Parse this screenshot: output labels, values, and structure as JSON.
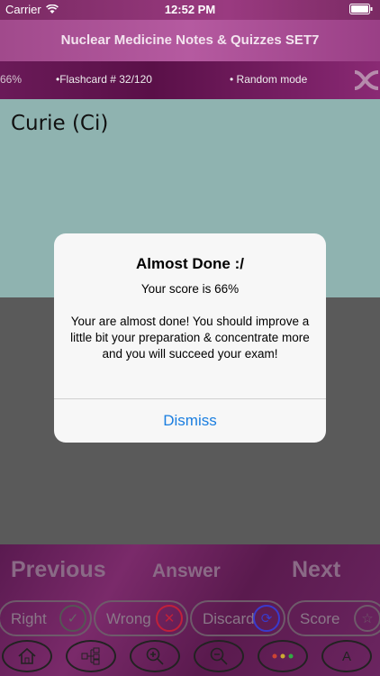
{
  "status_bar": {
    "carrier": "Carrier",
    "time": "12:52 PM"
  },
  "header": {
    "title": "Nuclear Medicine Notes & Quizzes SET7"
  },
  "info_bar": {
    "percent": "66%",
    "flashcard": "•Flashcard #  32/120",
    "mode": "• Random mode"
  },
  "card": {
    "term": "Curie (Ci)"
  },
  "nav": {
    "previous": "Previous",
    "answer": "Answer",
    "next": "Next"
  },
  "marks": {
    "right": "Right",
    "wrong": "Wrong",
    "discard": "Discard",
    "score": "Score"
  },
  "alert": {
    "title": "Almost Done :/",
    "score": "Your score is 66%",
    "message": "Your are almost done! You should improve a little bit your preparation & concentrate more and you will succeed your exam!",
    "button": "Dismiss"
  },
  "colors": {
    "alert_button": "#1a7ee0",
    "card_bg": "#8fb3b0",
    "header": "#a14a8c"
  },
  "icons": [
    "wifi-icon",
    "battery-icon",
    "shuffle-icon",
    "check-icon",
    "x-icon",
    "refresh-icon",
    "star-icon",
    "home-icon",
    "tree-icon",
    "zoom-in-icon",
    "zoom-out-icon",
    "dots-icon",
    "font-icon"
  ]
}
